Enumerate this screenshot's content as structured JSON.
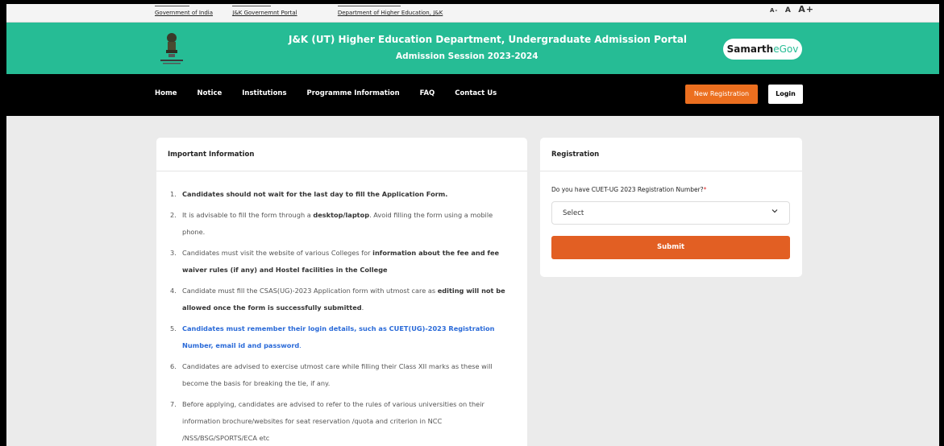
{
  "topbar": {
    "links": [
      "Government of India",
      "J&K Governemnt Portal",
      "Department of Higher Education, J&K"
    ],
    "font_small": "A-",
    "font_medium": "A",
    "font_large": "A+"
  },
  "header": {
    "title": "J&K (UT) Higher Education Department, Undergraduate Admission Portal",
    "subtitle": "Admission Session 2023-2024",
    "brand_part1": "Samarth",
    "brand_part2": "eGov",
    "bg_color": "#26bc95"
  },
  "nav": {
    "items": [
      "Home",
      "Notice",
      "Institutions",
      "Programme Information",
      "FAQ",
      "Contact Us"
    ],
    "new_registration": "New Registration",
    "login": "Login",
    "accent_color": "#ec6f1f"
  },
  "info": {
    "heading": "Important Information",
    "items": [
      {
        "num": "1.",
        "parts": [
          {
            "t": "Candidates should not wait for the last day to fill the Application Form.",
            "s": "b"
          }
        ]
      },
      {
        "num": "2.",
        "parts": [
          {
            "t": "It is advisable to fill the form through a ",
            "s": ""
          },
          {
            "t": "desktop/laptop",
            "s": "b"
          },
          {
            "t": ". Avoid filling the form using a mobile phone.",
            "s": ""
          }
        ]
      },
      {
        "num": "3.",
        "parts": [
          {
            "t": "Candidates must visit the website of various Colleges for ",
            "s": ""
          },
          {
            "t": "information about the fee and fee waiver rules (if any) and Hostel facilities in the College",
            "s": "b"
          }
        ]
      },
      {
        "num": "4.",
        "parts": [
          {
            "t": "Candidate must fill the CSAS(UG)-2023 Application form with utmost care as ",
            "s": ""
          },
          {
            "t": "editing will not be allowed once the form is successfully submitted",
            "s": "b"
          },
          {
            "t": ".",
            "s": ""
          }
        ]
      },
      {
        "num": "5.",
        "parts": [
          {
            "t": "Candidates must remember their login details, such as CUET(UG)-2023 Registration Number, email id and password",
            "s": "blue"
          },
          {
            "t": ".",
            "s": "blue2"
          }
        ]
      },
      {
        "num": "6.",
        "parts": [
          {
            "t": "Candidates are advised to exercise utmost care while filling their Class XII marks as these will become the basis for breaking the tie, if any.",
            "s": ""
          }
        ]
      },
      {
        "num": "7.",
        "parts": [
          {
            "t": "Before applying, candidates are advised to refer to the rules of various universities on their information brochure/websites for seat reservation /quota and criterion in NCC /NSS/BSG/SPORTS/ECA etc",
            "s": ""
          }
        ]
      }
    ]
  },
  "registration": {
    "heading": "Registration",
    "question": "Do you have CUET-UG 2023 Registration Number?",
    "required_mark": "*",
    "select_value": "Select",
    "submit_label": "Submit",
    "submit_color": "#e25f23"
  }
}
